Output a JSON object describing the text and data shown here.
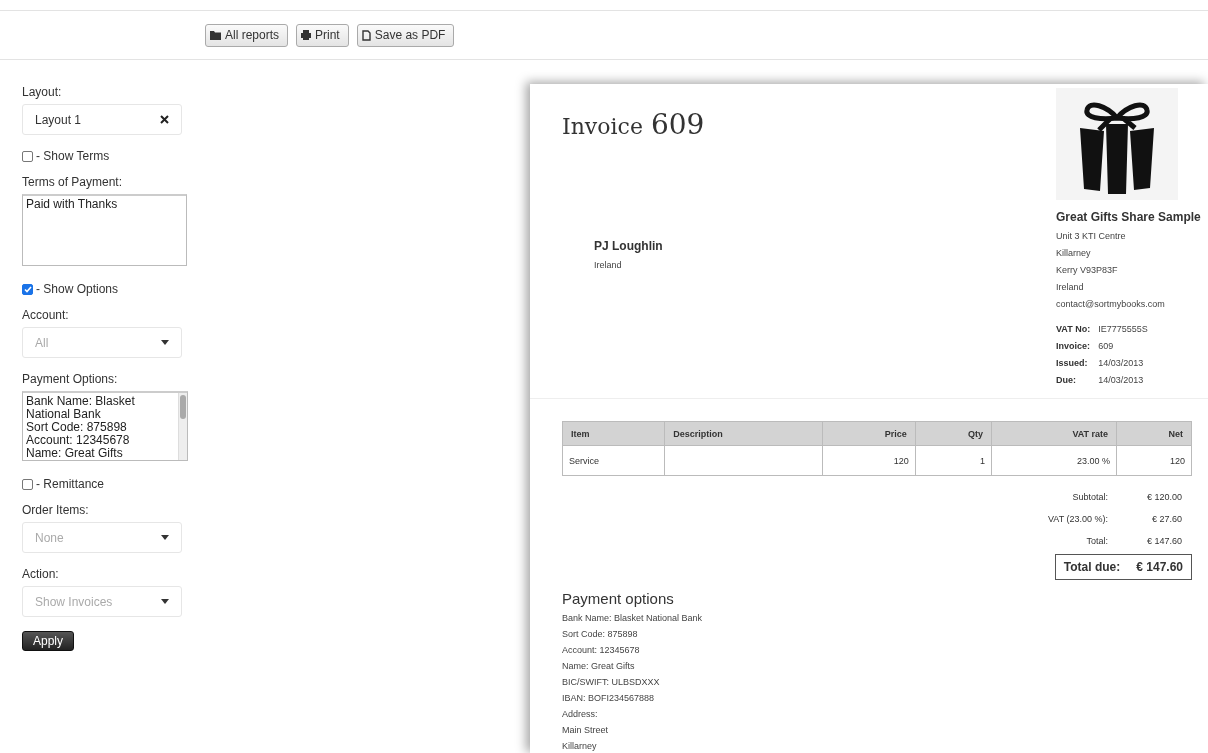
{
  "toolbar": {
    "buttons": [
      {
        "label": "All reports",
        "kind": "folder"
      },
      {
        "label": "Print",
        "kind": "print"
      },
      {
        "label": "Save as PDF",
        "kind": "file"
      }
    ]
  },
  "options": [
    {
      "kind": "select",
      "label": "Layout:",
      "value": "Layout 1",
      "clearable": true,
      "placeholder_style": false
    },
    {
      "kind": "checkbox",
      "label": "- Show Terms",
      "checked": false
    },
    {
      "kind": "textarea",
      "label": "Terms of Payment:",
      "lines": [
        "Paid with Thanks"
      ],
      "scrollbar": false
    },
    {
      "kind": "checkbox",
      "label": "- Show Options",
      "checked": true
    },
    {
      "kind": "select",
      "label": "Account:",
      "value": "All",
      "clearable": false,
      "placeholder_style": true
    },
    {
      "kind": "textarea",
      "label": "Payment Options:",
      "lines": [
        "Bank Name: Blasket National Bank",
        "Sort Code: 875898",
        "Account: 12345678",
        "Name: Great Gifts"
      ],
      "scrollbar": true
    },
    {
      "kind": "checkbox",
      "label": "- Remittance",
      "checked": false
    },
    {
      "kind": "select",
      "label": "Order Items:",
      "value": "None",
      "clearable": false,
      "placeholder_style": true
    },
    {
      "kind": "select",
      "label": "Action:",
      "value": "Show Invoices",
      "clearable": false,
      "placeholder_style": true
    }
  ],
  "apply_button": "Apply",
  "invoice": {
    "title": "Invoice",
    "number": "609",
    "client": {
      "name": "PJ Loughlin",
      "lines": [
        "Ireland"
      ]
    },
    "company": {
      "name": "Great Gifts Share Sample",
      "lines": [
        "Unit 3 KTI Centre",
        "Killarney",
        "Kerry V93P83F",
        "Ireland",
        "contact@sortmybooks.com"
      ]
    },
    "details": [
      {
        "label": "VAT No:",
        "value": "IE7775555S"
      },
      {
        "label": "Invoice:",
        "value": "609"
      },
      {
        "label": "Issued:",
        "value": "14/03/2013"
      },
      {
        "label": "Due:",
        "value": "14/03/2013"
      }
    ],
    "table": {
      "columns": [
        "Item",
        "Description",
        "Price",
        "Qty",
        "VAT rate",
        "Net"
      ],
      "rows": [
        [
          "Service",
          "",
          "120",
          "1",
          "23.00 %",
          "120"
        ]
      ]
    },
    "totals": [
      {
        "label": "Subtotal:",
        "value": "€ 120.00"
      },
      {
        "label": "VAT (23.00 %):",
        "value": "€ 27.60"
      },
      {
        "label": "Total:",
        "value": "€ 147.60"
      }
    ],
    "total_due": {
      "label": "Total due:",
      "value": "€ 147.60"
    },
    "payment_options": {
      "heading": "Payment options",
      "lines": [
        "Bank Name: Blasket National Bank",
        "Sort Code: 875898",
        "Account: 12345678",
        "Name: Great Gifts",
        "BIC/SWIFT: ULBSDXXX",
        "IBAN: BOFI234567888",
        "Address:",
        "Main Street",
        "Killarney"
      ]
    }
  }
}
